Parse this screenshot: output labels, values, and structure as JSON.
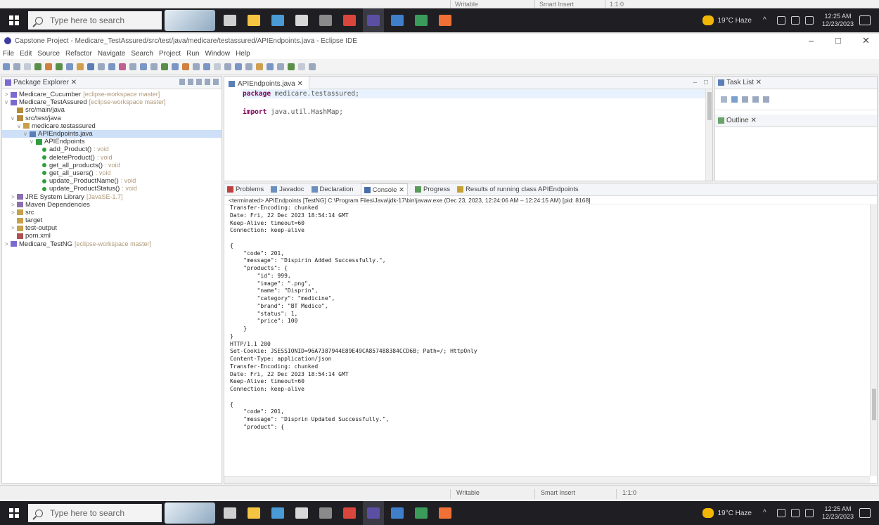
{
  "top_status": {
    "writable": "Writable",
    "insert_mode": "Smart Insert",
    "position": "1:1:0"
  },
  "taskbar": {
    "search_placeholder": "Type here to search",
    "apps": [
      {
        "name": "task-view-icon",
        "color": "#cfcfcf"
      },
      {
        "name": "file-explorer-icon",
        "color": "#f5c542"
      },
      {
        "name": "store-icon",
        "color": "#4a9ad6"
      },
      {
        "name": "settings-icon",
        "color": "#d8d8d8"
      },
      {
        "name": "terminal-icon",
        "color": "#8a8a8a"
      },
      {
        "name": "chrome-icon",
        "color": "#d9463b"
      },
      {
        "name": "eclipse-icon",
        "color": "#5a4fa3"
      },
      {
        "name": "word-icon",
        "color": "#3f7ec9"
      },
      {
        "name": "chrome-dev-icon",
        "color": "#3a9b5a"
      },
      {
        "name": "postman-icon",
        "color": "#f07035"
      }
    ],
    "weather": "19°C Haze",
    "clock_time": "12:25 AM",
    "clock_date": "12/23/2023"
  },
  "window": {
    "title": "Capstone Project - Medicare_TestAssured/src/test/java/medicare/testassured/APIEndpoints.java - Eclipse IDE",
    "minimize": "–",
    "maximize": "□",
    "close": "✕"
  },
  "menu": [
    "File",
    "Edit",
    "Source",
    "Refactor",
    "Navigate",
    "Search",
    "Project",
    "Run",
    "Window",
    "Help"
  ],
  "package_explorer": {
    "tab": "Package Explorer ✕",
    "rows": [
      {
        "indent": 0,
        "tw": ">",
        "icon": "#7c6ad0",
        "label": "Medicare_Cucumber",
        "dec": "[eclipse-workspace master]"
      },
      {
        "indent": 0,
        "tw": "v",
        "icon": "#7c6ad0",
        "label": "Medicare_TestAssured",
        "dec": "[eclipse-workspace master]"
      },
      {
        "indent": 1,
        "tw": "",
        "icon": "#b58a3a",
        "label": "src/main/java",
        "dec": ""
      },
      {
        "indent": 1,
        "tw": "v",
        "icon": "#b58a3a",
        "label": "src/test/java",
        "dec": ""
      },
      {
        "indent": 2,
        "tw": "v",
        "icon": "#c7a04a",
        "label": "medicare.testassured",
        "dec": ""
      },
      {
        "indent": 3,
        "tw": "v",
        "icon": "#5a7fb6",
        "label": "APIEndpoints.java",
        "dec": "",
        "sel": true
      },
      {
        "indent": 4,
        "tw": "v",
        "icon": "#2e9e3c",
        "label": "APIEndpoints",
        "dec": ""
      },
      {
        "indent": 5,
        "tw": "",
        "dot": true,
        "label": "add_Product()",
        "dec": ": void"
      },
      {
        "indent": 5,
        "tw": "",
        "dot": true,
        "label": "deleteProduct()",
        "dec": ": void"
      },
      {
        "indent": 5,
        "tw": "",
        "dot": true,
        "label": "get_all_products()",
        "dec": ": void"
      },
      {
        "indent": 5,
        "tw": "",
        "dot": true,
        "label": "get_all_users()",
        "dec": ": void"
      },
      {
        "indent": 5,
        "tw": "",
        "dot": true,
        "label": "update_ProductName()",
        "dec": ": void"
      },
      {
        "indent": 5,
        "tw": "",
        "dot": true,
        "label": "update_ProductStatus()",
        "dec": ": void"
      },
      {
        "indent": 1,
        "tw": ">",
        "icon": "#8a6fb0",
        "label": "JRE System Library",
        "dec": "[JavaSE-1.7]"
      },
      {
        "indent": 1,
        "tw": ">",
        "icon": "#8a6fb0",
        "label": "Maven Dependencies",
        "dec": ""
      },
      {
        "indent": 1,
        "tw": ">",
        "icon": "#c7a04a",
        "label": "src",
        "dec": ""
      },
      {
        "indent": 1,
        "tw": "",
        "icon": "#c7a04a",
        "label": "target",
        "dec": ""
      },
      {
        "indent": 1,
        "tw": ">",
        "icon": "#c7a04a",
        "label": "test-output",
        "dec": ""
      },
      {
        "indent": 1,
        "tw": "",
        "icon": "#b05050",
        "label": "pom.xml",
        "dec": ""
      },
      {
        "indent": 0,
        "tw": ">",
        "icon": "#7c6ad0",
        "label": "Medicare_TestNG",
        "dec": "[eclipse-workspace master]"
      }
    ]
  },
  "editor": {
    "tab": "APIEndpoints.java ✕",
    "lines": [
      "package medicare.testassured;",
      "",
      "import java.util.HashMap;"
    ]
  },
  "right_pane": {
    "tasklist_tab": "Task List ✕",
    "outline_tab": "Outline ✕"
  },
  "console": {
    "tabs": [
      "Problems",
      "Javadoc",
      "Declaration",
      "Console ✕",
      "Progress",
      "Results of running class APIEndpoints"
    ],
    "terminated": "<terminated> APIEndpoints [TestNG] C:\\Program Files\\Java\\jdk-17\\bin\\javaw.exe (Dec 23, 2023, 12:24:06 AM – 12:24:15 AM) [pid: 8168]",
    "lines": [
      "Transfer-Encoding: chunked",
      "Date: Fri, 22 Dec 2023 18:54:14 GMT",
      "Keep-Alive: timeout=60",
      "Connection: keep-alive",
      "",
      "{",
      "    \"code\": 201,",
      "    \"message\": \"Dispirin Added Successfully.\",",
      "    \"products\": {",
      "        \"id\": 999,",
      "        \"image\": \".png\",",
      "        \"name\": \"Disprin\",",
      "        \"category\": \"medicine\",",
      "        \"brand\": \"BT Medico\",",
      "        \"status\": 1,",
      "        \"price\": 100",
      "    }",
      "}",
      "HTTP/1.1 200",
      "Set-Cookie: JSESSIONID=96A7387944E89E49CA857488384CCD6B; Path=/; HttpOnly",
      "Content-Type: application/json",
      "Transfer-Encoding: chunked",
      "Date: Fri, 22 Dec 2023 18:54:14 GMT",
      "Keep-Alive: timeout=60",
      "Connection: keep-alive",
      "",
      "{",
      "    \"code\": 201,",
      "    \"message\": \"Disprin Updated Successfully.\",",
      "    \"product\": {"
    ]
  },
  "status": {
    "writable": "Writable",
    "insert_mode": "Smart Insert",
    "position": "1:1:0"
  }
}
